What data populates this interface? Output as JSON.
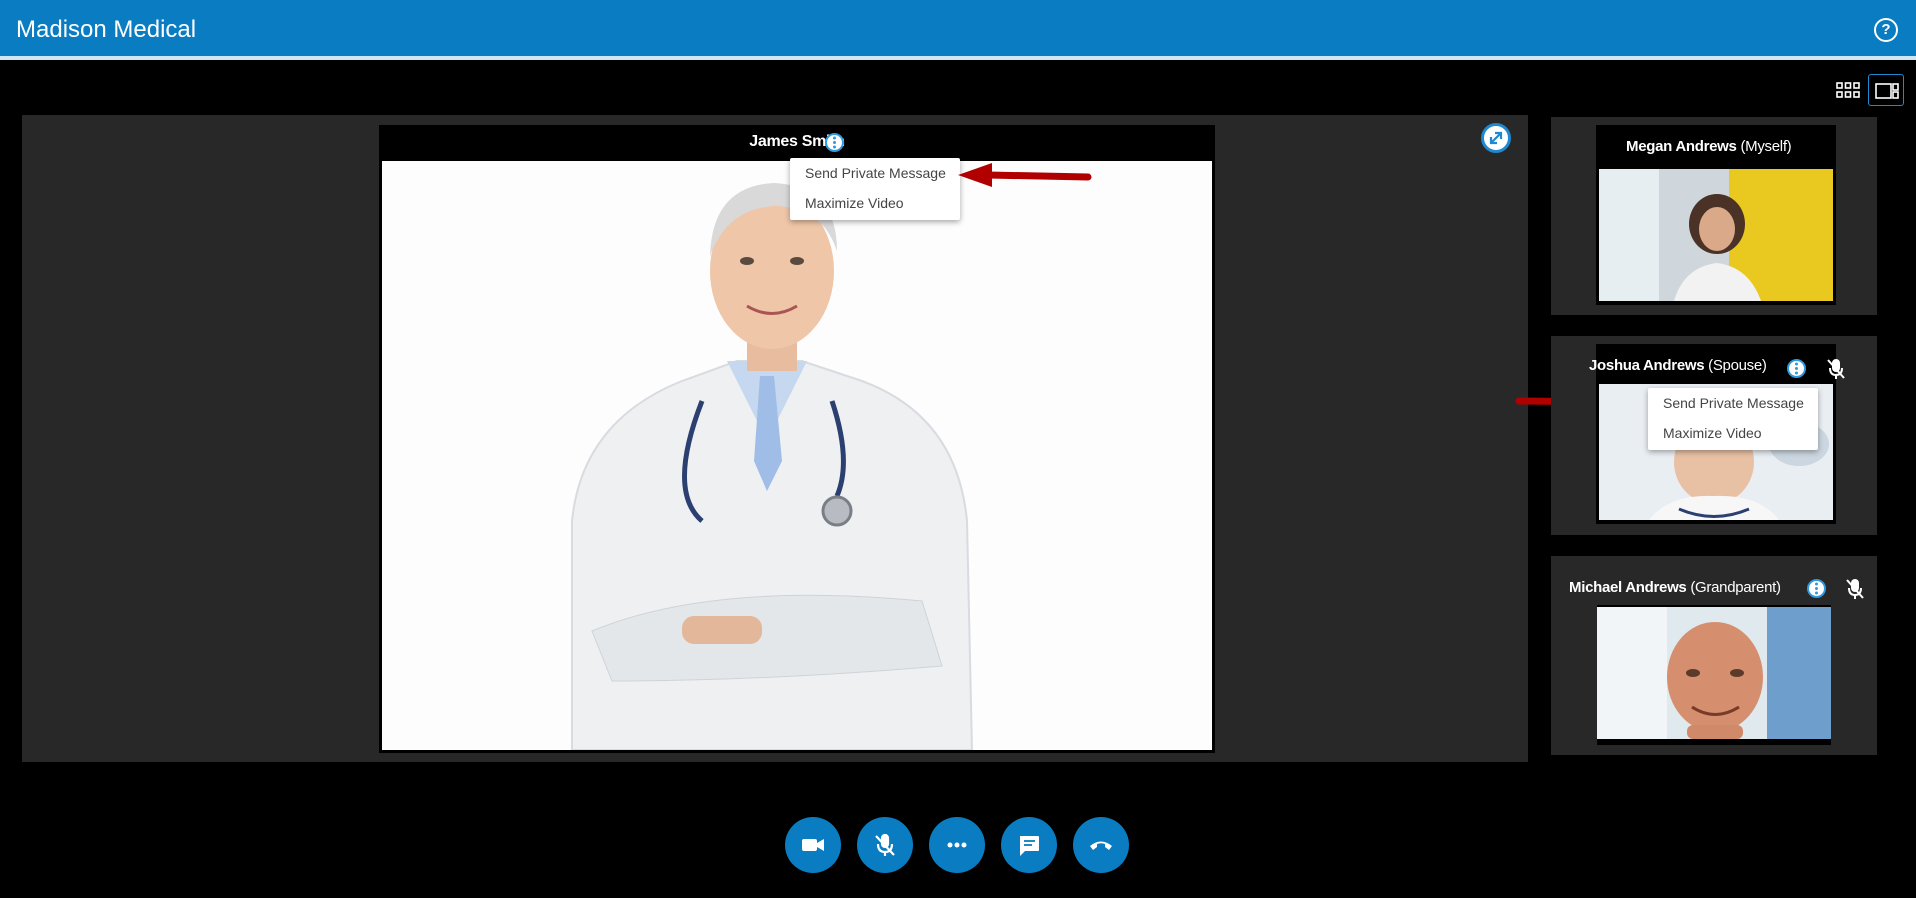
{
  "app": {
    "title": "Madison Medical"
  },
  "colors": {
    "brand": "#0a7cc1",
    "stage": "#282828",
    "arrow": "#b00000"
  },
  "icons": {
    "help": "?",
    "grid_view": "grid-view-icon",
    "speaker_view": "speaker-view-icon"
  },
  "main_video": {
    "participant": "James Smith",
    "menu": [
      "Send Private Message",
      "Maximize Video"
    ]
  },
  "participants": [
    {
      "name": "Megan Andrews",
      "role": "(Myself)",
      "muted": false
    },
    {
      "name": "Joshua Andrews",
      "role": "(Spouse)",
      "muted": true,
      "menu": [
        "Send Private Message",
        "Maximize Video"
      ]
    },
    {
      "name": "Michael Andrews",
      "role": "(Grandparent)",
      "muted": true
    }
  ],
  "controls": [
    "camera",
    "mute-microphone",
    "more-options",
    "chat",
    "end-call"
  ]
}
